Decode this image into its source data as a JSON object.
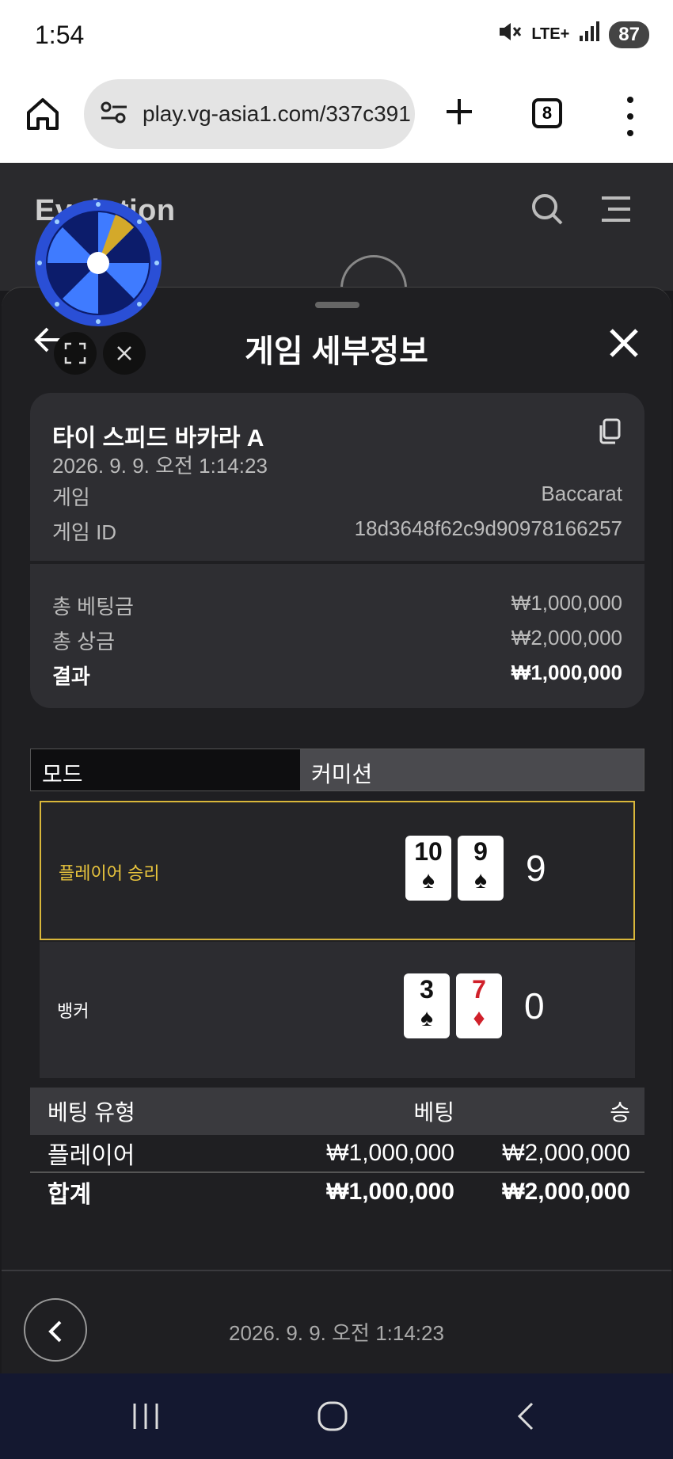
{
  "status": {
    "time": "1:54",
    "network": "LTE+",
    "battery": "87"
  },
  "browser": {
    "url": "play.vg-asia1.com/337c391",
    "tab_count": "8"
  },
  "app": {
    "logo_text": "Evolution"
  },
  "sheet": {
    "title": "게임 세부정보",
    "game_name": "타이 스피드 바카라 A",
    "game_datetime": "2026. 9. 9. 오전 1:14:23",
    "game_label": "게임",
    "game_value": "Baccarat",
    "game_id_label": "게임 ID",
    "game_id_value": "18d3648f62c9d90978166257",
    "total_bet_label": "총 베팅금",
    "total_bet_value": "₩1,000,000",
    "total_prize_label": "총 상금",
    "total_prize_value": "₩2,000,000",
    "result_label": "결과",
    "result_value": "₩1,000,000"
  },
  "mode": {
    "label": "모드",
    "value": "커미션"
  },
  "hands": {
    "player": {
      "label": "플레이어 승리",
      "score": "9",
      "cards": [
        {
          "rank": "10",
          "suit": "♠",
          "color": "black"
        },
        {
          "rank": "9",
          "suit": "♠",
          "color": "black"
        }
      ]
    },
    "banker": {
      "label": "뱅커",
      "score": "0",
      "cards": [
        {
          "rank": "3",
          "suit": "♠",
          "color": "black"
        },
        {
          "rank": "7",
          "suit": "♦",
          "color": "red"
        }
      ]
    }
  },
  "bets": {
    "headers": {
      "type": "베팅 유형",
      "bet": "베팅",
      "win": "승"
    },
    "rows": [
      {
        "type": "플레이어",
        "bet": "₩1,000,000",
        "win": "₩2,000,000"
      }
    ],
    "total": {
      "type": "합계",
      "bet": "₩1,000,000",
      "win": "₩2,000,000"
    }
  },
  "footer": {
    "datetime": "2026. 9. 9. 오전 1:14:23"
  },
  "colors": {
    "win_border": "#d9b73a",
    "win_label": "#e8c43d",
    "sheet_bg": "#1f1f22",
    "card_bg": "#2e2e32",
    "red_suit": "#d0202a"
  }
}
